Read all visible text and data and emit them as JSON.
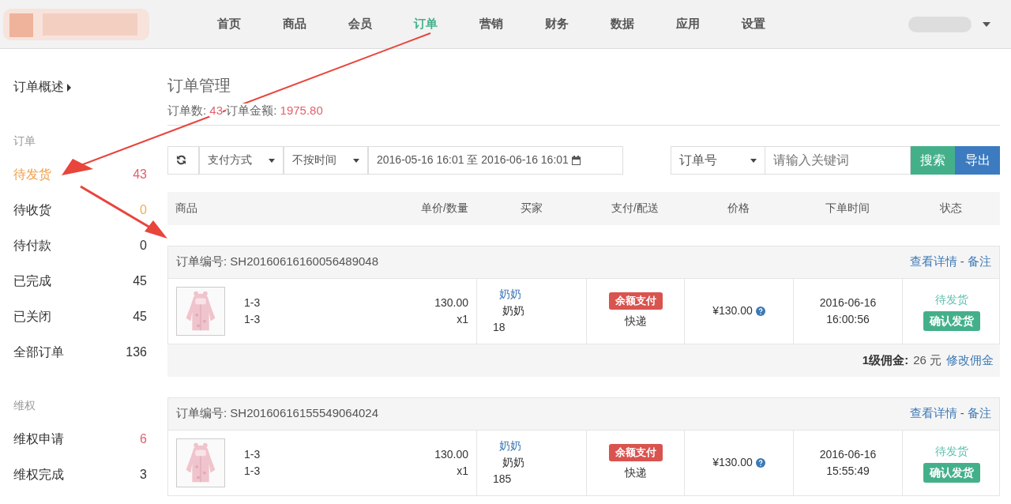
{
  "nav": {
    "items": [
      {
        "label": "首页",
        "selected": false
      },
      {
        "label": "商品",
        "selected": false
      },
      {
        "label": "会员",
        "selected": false
      },
      {
        "label": "订单",
        "selected": true
      },
      {
        "label": "营销",
        "selected": false
      },
      {
        "label": "财务",
        "selected": false
      },
      {
        "label": "数据",
        "selected": false
      },
      {
        "label": "应用",
        "selected": false
      },
      {
        "label": "设置",
        "selected": false
      }
    ]
  },
  "sidebar": {
    "overview": "订单概述",
    "sections": [
      {
        "title": "订单",
        "items": [
          {
            "label": "待发货",
            "count": "43",
            "color": "#e0616e",
            "selected": true
          },
          {
            "label": "待收货",
            "count": "0",
            "color": "#f0ad4e",
            "selected": false
          },
          {
            "label": "待付款",
            "count": "0",
            "color": "#333333",
            "selected": false
          },
          {
            "label": "已完成",
            "count": "45",
            "color": "#333333",
            "selected": false
          },
          {
            "label": "已关闭",
            "count": "45",
            "color": "#333333",
            "selected": false
          },
          {
            "label": "全部订单",
            "count": "136",
            "color": "#333333",
            "selected": false
          }
        ]
      },
      {
        "title": "维权",
        "items": [
          {
            "label": "维权申请",
            "count": "6",
            "color": "#e0616e",
            "selected": false
          },
          {
            "label": "维权完成",
            "count": "3",
            "color": "#333333",
            "selected": false
          }
        ]
      }
    ]
  },
  "page": {
    "title": "订单管理",
    "summary": [
      {
        "label": "订单数:",
        "value": "43"
      },
      {
        "label": "订单金额:",
        "value": "1975.80"
      }
    ]
  },
  "filters": {
    "payment": "支付方式",
    "time": "不按时间",
    "date_range": "2016-05-16 16:01 至 2016-06-16 16:01",
    "search_by": "订单号",
    "keyword_placeholder": "请输入关键词",
    "search_button": "搜索",
    "export_button": "导出"
  },
  "table": {
    "columns": [
      "商品",
      "单价/数量",
      "买家",
      "支付/配送",
      "价格",
      "下单时间",
      "状态"
    ],
    "orders": [
      {
        "order_label": "订单编号:",
        "order_no": "SH20160616160056489048",
        "detail_link": "查看详情",
        "separator": "-",
        "note_link": "备注",
        "product_lines": [
          "1-3",
          "1-3"
        ],
        "unit_price": "130.00",
        "quantity": "x1",
        "buyer_lines": [
          "奶奶",
          "奶奶",
          "18"
        ],
        "payment_badge": "余额支付",
        "delivery": "快递",
        "price": "¥130.00",
        "date": "2016-06-16",
        "time": "16:00:56",
        "status": "待发货",
        "action": "确认发货",
        "commission": {
          "label": "1级佣金:",
          "value": "26 元",
          "link": "修改佣金"
        }
      },
      {
        "order_label": "订单编号:",
        "order_no": "SH20160616155549064024",
        "detail_link": "查看详情",
        "separator": "-",
        "note_link": "备注",
        "product_lines": [
          "1-3",
          "1-3"
        ],
        "unit_price": "130.00",
        "quantity": "x1",
        "buyer_lines": [
          "奶奶",
          "奶奶",
          "185"
        ],
        "payment_badge": "余额支付",
        "delivery": "快递",
        "price": "¥130.00",
        "date": "2016-06-16",
        "time": "15:55:49",
        "status": "待发货",
        "action": "确认发货"
      }
    ]
  }
}
